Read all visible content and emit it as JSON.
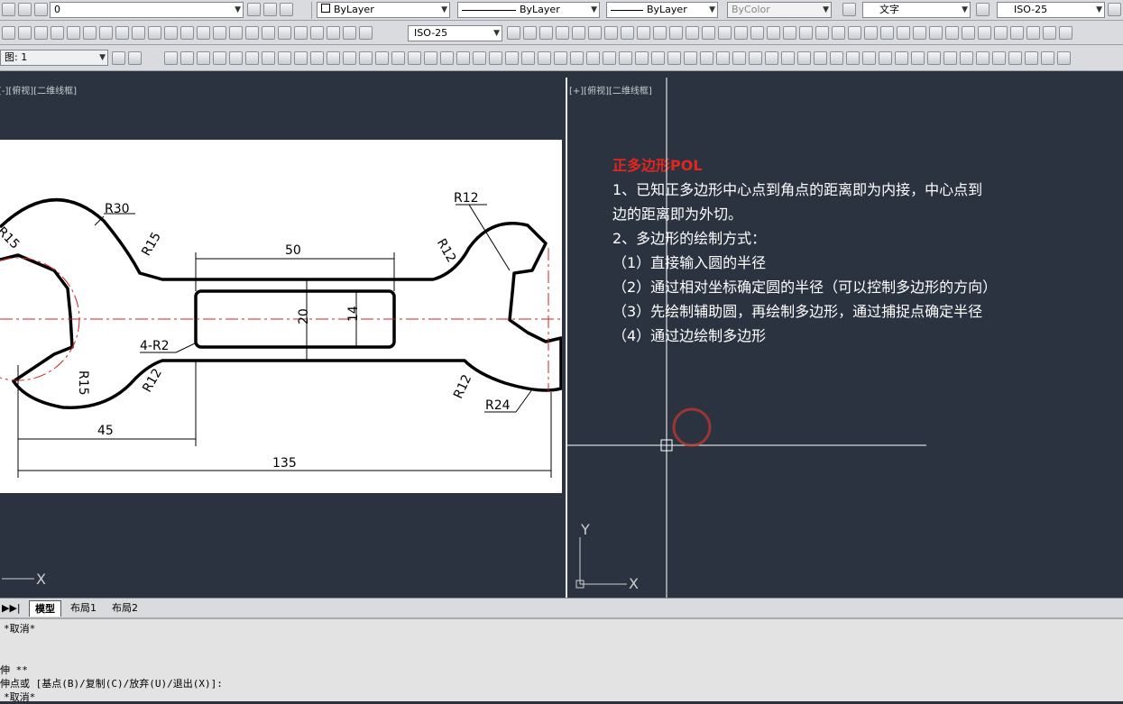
{
  "toolbar": {
    "layer_name": "0",
    "color_value": "ByLayer",
    "linetype_value": "ByLayer",
    "lineweight_value": "ByLayer",
    "plotstyle_value": "ByColor",
    "text_style": "文字",
    "dim_style_top": "ISO-25",
    "dim_style_row2": "ISO-25",
    "row3_field": "图: 1"
  },
  "viewports": {
    "left_label": "[-][俯视][二维线框]",
    "right_label": "[+][俯视][二维线框]"
  },
  "drawing": {
    "dims": [
      "R30",
      "R15",
      "R15",
      "50",
      "20",
      "14",
      "4-R2",
      "R15",
      "R12",
      "45",
      "135",
      "R12",
      "R12",
      "R12",
      "R24"
    ]
  },
  "notes": {
    "title": "正多边形POL",
    "lines": [
      "1、已知正多边形中心点到角点的距离即为内接，中心点到",
      "边的距离即为外切。",
      "2、多边形的绘制方式：",
      "（1）直接输入圆的半径",
      "（2）通过相对坐标确定圆的半径（可以控制多边形的方向）",
      "（3）先绘制辅助圆，再绘制多边形，通过捕捉点确定半径",
      "（4）通过边绘制多边形"
    ]
  },
  "ucs": {
    "x": "X",
    "y": "Y"
  },
  "tabs": [
    "模型",
    "布局1",
    "布局2"
  ],
  "command": {
    "lines": [
      "*取消*",
      "",
      "伸 **",
      "伸点或 [基点(B)/复制(C)/放弃(U)/退出(X)]:",
      "*取消*"
    ]
  },
  "colors": {
    "canvas": "#2b3340",
    "note_title": "#e0261e",
    "centerline": "#d62020",
    "snap_circle": "#c0392b"
  }
}
